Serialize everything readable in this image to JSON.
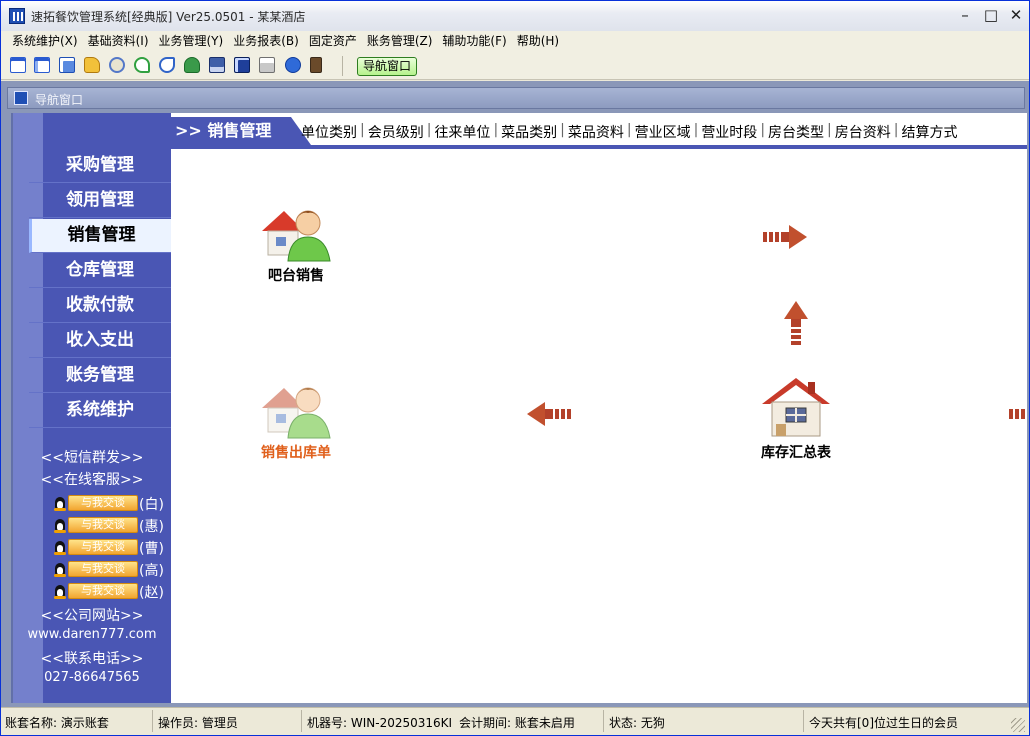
{
  "window": {
    "title": "速拓餐饮管理系统[经典版] Ver25.0501  -  某某酒店",
    "min_glyph": "–",
    "max_glyph": "□",
    "close_glyph": "✕"
  },
  "menubar": {
    "items": [
      "系统维护(X)",
      "基础资料(I)",
      "业务管理(Y)",
      "业务报表(B)",
      "固定资产",
      "账务管理(Z)",
      "辅助功能(F)",
      "帮助(H)"
    ]
  },
  "toolbar": {
    "icons": [
      "window-icon",
      "form-icon",
      "windows-icon",
      "key-icon",
      "search-icon",
      "refresh-icon",
      "refresh-alt-icon",
      "users-icon",
      "keyboard-icon",
      "save-icon",
      "print-icon",
      "help-icon",
      "exit-icon"
    ],
    "nav_button": "导航窗口"
  },
  "child_window": {
    "title": "导航窗口"
  },
  "leftnav": {
    "items": [
      "采购管理",
      "领用管理",
      "销售管理",
      "仓库管理",
      "收款付款",
      "收入支出",
      "账务管理",
      "系统维护"
    ],
    "active_index": 2,
    "sms": "<<短信群发>>",
    "online_service": "<<在线客服>>",
    "qq_button": "与我交谈",
    "qq_contacts": [
      "(白)",
      "(惠)",
      "(曹)",
      "(高)",
      "(赵)"
    ],
    "website_label": "<<公司网站>>",
    "website": "www.daren777.com",
    "phone_label": "<<联系电话>>",
    "phone": "027-86647565"
  },
  "content": {
    "section_title": ">> 销售管理",
    "quick_links": [
      "单位类别",
      "会员级别",
      "往来单位",
      "菜品类别",
      "菜品资料",
      "营业区域",
      "营业时段",
      "房台类型",
      "房台资料",
      "结算方式"
    ],
    "separator": "|"
  },
  "workflow": {
    "nodes": [
      {
        "label": "吧台销售",
        "icon": "person-house-icon"
      },
      {
        "label": "销售出库单",
        "icon": "person-house-icon"
      },
      {
        "label": "库存汇总表",
        "icon": "house-icon"
      }
    ]
  },
  "statusbar": {
    "account": "账套名称: 演示账套",
    "operator": "操作员: 管理员",
    "machine": "机器号: WIN-20250316KI",
    "period": "会计期间: 账套未启用",
    "status": "状态: 无狗",
    "birthday": "今天共有[0]位过生日的会员"
  }
}
